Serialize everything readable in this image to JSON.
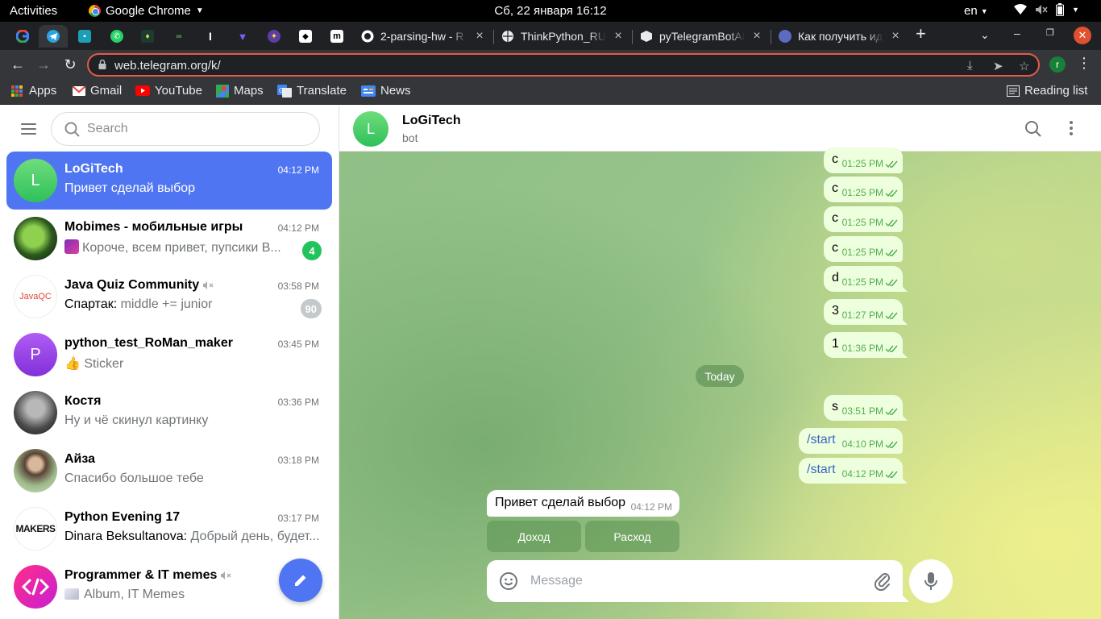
{
  "system_bar": {
    "activities": "Activities",
    "app_name": "Google Chrome",
    "clock": "Сб, 22 января  16:12",
    "language": "en"
  },
  "browser": {
    "tabs": [
      {
        "title": "2-parsing-hw - R",
        "icon": "github-icon"
      },
      {
        "title": "ThinkPython_RU",
        "icon": "globe-icon"
      },
      {
        "title": "pyTelegramBotAPI",
        "icon": "package-icon"
      },
      {
        "title": "Как получить ид",
        "icon": "tab-favicon-icon"
      }
    ],
    "url": "web.telegram.org/k/",
    "profile_initial": "r",
    "bookmarks": {
      "apps": "Apps",
      "gmail": "Gmail",
      "youtube": "YouTube",
      "maps": "Maps",
      "translate": "Translate",
      "news": "News",
      "reading_list": "Reading list"
    }
  },
  "telegram": {
    "search_placeholder": "Search",
    "chats": [
      {
        "name": "LoGiTech",
        "time": "04:12 PM",
        "preview": "Привет сделай выбор",
        "avatar_letter": "L",
        "active": true
      },
      {
        "name": "Mobimes - мобильные игры",
        "time": "04:12 PM",
        "preview": "Короче, всем привет, пупсики В...",
        "unread": "4"
      },
      {
        "name": "Java Quiz Community",
        "time": "03:58 PM",
        "sender": "Спартак:",
        "preview": " middle += junior",
        "unread": "90",
        "avatar_text": "JavaQC",
        "muted": true
      },
      {
        "name": "python_test_RoMan_maker",
        "time": "03:45 PM",
        "preview": "👍 Sticker",
        "avatar_letter": "P"
      },
      {
        "name": "Костя",
        "time": "03:36 PM",
        "preview": "Ну и чё скинул картинку"
      },
      {
        "name": "Айза",
        "time": "03:18 PM",
        "preview": "Спасибо большое тебе"
      },
      {
        "name": "Python Evening 17",
        "time": "03:17 PM",
        "sender": "Dinara Beksultanova:",
        "preview": " Добрый день, будет...",
        "avatar_text": "MAKERS"
      },
      {
        "name": "Programmer & IT memes",
        "time": "",
        "preview": "Album, IT Memes",
        "muted": true
      }
    ],
    "header": {
      "title": "LoGiTech",
      "subtitle": "bot",
      "avatar_letter": "L"
    },
    "messages_out": [
      {
        "text": "с",
        "time": "01:25 PM"
      },
      {
        "text": "с",
        "time": "01:25 PM"
      },
      {
        "text": "с",
        "time": "01:25 PM"
      },
      {
        "text": "с",
        "time": "01:25 PM"
      },
      {
        "text": "d",
        "time": "01:25 PM"
      },
      {
        "text": "3",
        "time": "01:27 PM"
      },
      {
        "text": "1",
        "time": "01:36 PM"
      },
      {
        "text": "s",
        "time": "03:51 PM"
      },
      {
        "text": "/start",
        "time": "04:10 PM"
      },
      {
        "text": "/start",
        "time": "04:12 PM"
      }
    ],
    "day_separator": "Today",
    "message_in": {
      "text": "Привет сделай выбор",
      "time": "04:12 PM"
    },
    "keyboard": [
      "Доход",
      "Расход"
    ],
    "composer_placeholder": "Message"
  }
}
